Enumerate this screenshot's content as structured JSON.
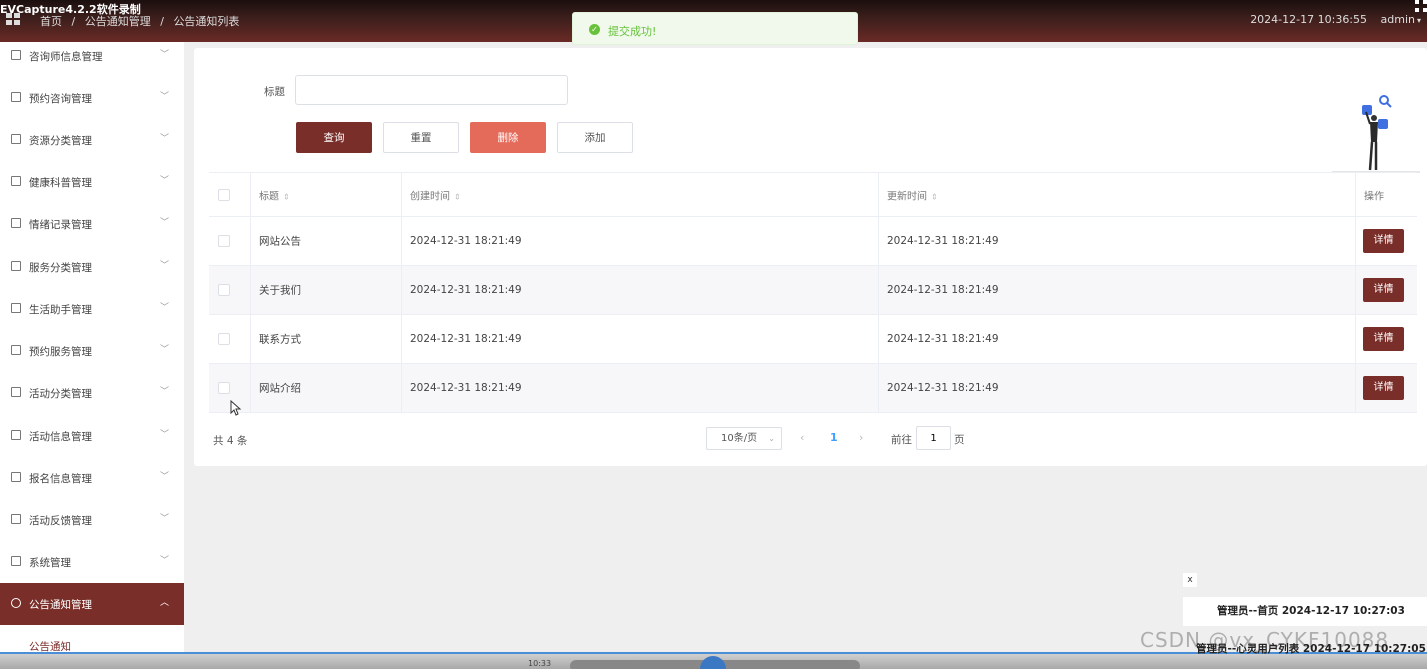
{
  "app": {
    "capture_title": "EVCapture4.2.2软件录制"
  },
  "topbar": {
    "breadcrumb": [
      "首页",
      "/",
      "公告通知管理",
      "/",
      "公告通知列表"
    ],
    "datetime": "2024-12-17 10:36:55",
    "user": "admin",
    "user_caret": "▾"
  },
  "toast": {
    "message": "提交成功!",
    "check": "✓"
  },
  "sidebar": {
    "items": [
      {
        "label": "咨询师信息管理",
        "chev": "﹀"
      },
      {
        "label": "预约咨询管理",
        "chev": "﹀"
      },
      {
        "label": "资源分类管理",
        "chev": "﹀"
      },
      {
        "label": "健康科普管理",
        "chev": "﹀"
      },
      {
        "label": "情绪记录管理",
        "chev": "﹀"
      },
      {
        "label": "服务分类管理",
        "chev": "﹀"
      },
      {
        "label": "生活助手管理",
        "chev": "﹀"
      },
      {
        "label": "预约服务管理",
        "chev": "﹀"
      },
      {
        "label": "活动分类管理",
        "chev": "﹀"
      },
      {
        "label": "活动信息管理",
        "chev": "﹀"
      },
      {
        "label": "报名信息管理",
        "chev": "﹀"
      },
      {
        "label": "活动反馈管理",
        "chev": "﹀"
      },
      {
        "label": "系统管理",
        "chev": "﹀"
      },
      {
        "label": "公告通知管理",
        "chev": "︿"
      }
    ],
    "sub_item": "公告通知"
  },
  "search": {
    "label": "标题",
    "value": "",
    "placeholder": ""
  },
  "buttons": {
    "query": "查询",
    "reset": "重置",
    "delete": "删除",
    "add": "添加"
  },
  "table": {
    "headers": {
      "title": "标题",
      "created": "创建时间",
      "updated": "更新时间",
      "actions": "操作",
      "sort": "⇕"
    },
    "rows": [
      {
        "title": "网站公告",
        "created": "2024-12-31 18:21:49",
        "updated": "2024-12-31 18:21:49",
        "action": "详情"
      },
      {
        "title": "关于我们",
        "created": "2024-12-31 18:21:49",
        "updated": "2024-12-31 18:21:49",
        "action": "详情"
      },
      {
        "title": "联系方式",
        "created": "2024-12-31 18:21:49",
        "updated": "2024-12-31 18:21:49",
        "action": "详情"
      },
      {
        "title": "网站介绍",
        "created": "2024-12-31 18:21:49",
        "updated": "2024-12-31 18:21:49",
        "action": "详情"
      }
    ]
  },
  "pagination": {
    "total": "共 4 条",
    "page_size": "10条/页",
    "dropdown": "⌄",
    "prev": "‹",
    "current_page": "1",
    "next": "›",
    "goto_label": "前往",
    "goto_value": "1",
    "goto_suffix": "页"
  },
  "notifications": {
    "close": "x",
    "first": "管理员--首页 2024-12-17 10:27:03",
    "second": "管理员--心灵用户列表 2024-12-17 10:27:05"
  },
  "watermark": "CSDN @vx_CYKF10088",
  "media": {
    "time": "10:33"
  },
  "colors": {
    "primary": "#7a2e29",
    "danger": "#e46a5a",
    "success": "#67c23a",
    "link": "#409eff"
  }
}
